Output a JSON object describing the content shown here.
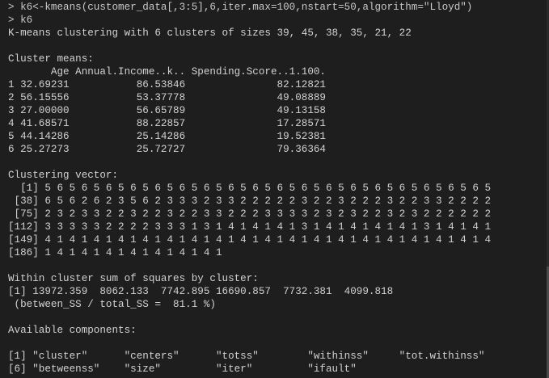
{
  "console": {
    "lines": [
      "> k6<-kmeans(customer_data[,3:5],6,iter.max=100,nstart=50,algorithm=\"Lloyd\")",
      "> k6",
      "K-means clustering with 6 clusters of sizes 39, 45, 38, 35, 21, 22",
      "",
      "Cluster means:",
      "       Age Annual.Income..k.. Spending.Score..1.100.",
      "1 32.69231           86.53846               82.12821",
      "2 56.15556           53.37778               49.08889",
      "3 27.00000           56.65789               49.13158",
      "4 41.68571           88.22857               17.28571",
      "5 44.14286           25.14286               19.52381",
      "6 25.27273           25.72727               79.36364",
      "",
      "Clustering vector:",
      "  [1] 5 6 5 6 5 6 5 6 5 6 5 6 5 6 5 6 5 6 5 6 5 6 5 6 5 6 5 6 5 6 5 6 5 6 5 6 5",
      " [38] 6 5 6 2 6 2 3 5 6 2 3 3 3 2 3 3 2 2 2 2 2 3 2 2 3 2 2 2 3 2 2 3 3 2 2 2 2",
      " [75] 2 3 2 3 3 2 2 3 2 2 3 2 2 3 3 2 2 2 3 3 3 3 2 3 2 3 2 2 3 2 3 2 2 2 2 2 2",
      "[112] 3 3 3 3 3 2 2 2 2 3 3 3 1 3 1 4 1 4 1 4 1 3 1 4 1 4 1 4 1 4 1 3 1 4 1 4 1",
      "[149] 4 1 4 1 4 1 4 1 4 1 4 1 4 1 4 1 4 1 4 1 4 1 4 1 4 1 4 1 4 1 4 1 4 1 4 1 4",
      "[186] 1 4 1 4 1 4 1 4 1 4 1 4 1 4 1",
      "",
      "Within cluster sum of squares by cluster:",
      "[1] 13972.359  8062.133  7742.895 16690.857  7732.381  4099.818",
      " (between_SS / total_SS =  81.1 %)",
      "",
      "Available components:",
      "",
      "[1] \"cluster\"      \"centers\"      \"totss\"        \"withinss\"     \"tot.withinss\"",
      "[6] \"betweenss\"    \"size\"         \"iter\"         \"ifault\""
    ]
  }
}
